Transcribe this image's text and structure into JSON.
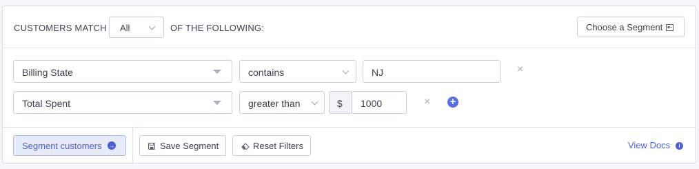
{
  "header": {
    "customers_match_label": "CUSTOMERS MATCH",
    "match_select_value": "All",
    "following_label": "OF THE FOLLOWING:",
    "choose_segment_label": "Choose a Segment"
  },
  "filters": [
    {
      "field": "Billing State",
      "operator": "contains",
      "value": "NJ"
    },
    {
      "field": "Total Spent",
      "operator": "greater than",
      "currency": "$",
      "value": "1000"
    }
  ],
  "icons": {
    "remove": "×",
    "add": "+",
    "arrow": "→",
    "info": "i"
  },
  "footer": {
    "segment_customers_label": "Segment customers",
    "save_segment_label": "Save Segment",
    "reset_filters_label": "Reset Filters",
    "view_docs_label": "View Docs"
  },
  "colors": {
    "accent": "#4c5fd1",
    "accent_bg": "#e8ebfb",
    "border": "#c9d0da"
  }
}
